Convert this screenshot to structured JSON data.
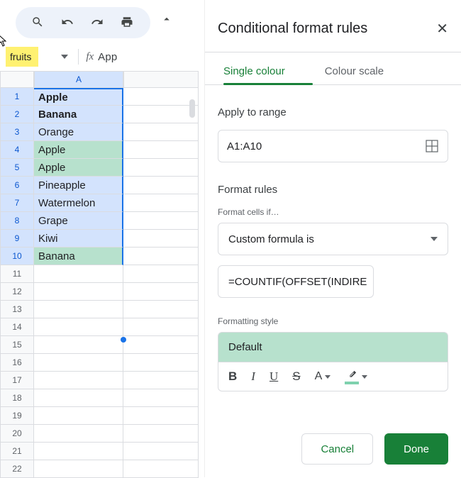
{
  "nameBox": "fruits",
  "formulaBar": "App",
  "columnHeaders": {
    "A": "A"
  },
  "rows": [
    {
      "n": 1,
      "A": "Apple",
      "bold": true,
      "hl": false
    },
    {
      "n": 2,
      "A": "Banana",
      "bold": true,
      "hl": false
    },
    {
      "n": 3,
      "A": "Orange",
      "bold": false,
      "hl": false
    },
    {
      "n": 4,
      "A": "Apple",
      "bold": false,
      "hl": true
    },
    {
      "n": 5,
      "A": "Apple",
      "bold": false,
      "hl": true
    },
    {
      "n": 6,
      "A": "Pineapple",
      "bold": false,
      "hl": false
    },
    {
      "n": 7,
      "A": "Watermelon",
      "bold": false,
      "hl": false
    },
    {
      "n": 8,
      "A": "Grape",
      "bold": false,
      "hl": false
    },
    {
      "n": 9,
      "A": "Kiwi",
      "bold": false,
      "hl": false
    },
    {
      "n": 10,
      "A": "Banana",
      "bold": false,
      "hl": true
    }
  ],
  "emptyRowsFrom": 11,
  "emptyRowsTo": 22,
  "panel": {
    "title": "Conditional format rules",
    "tabs": {
      "single": "Single colour",
      "scale": "Colour scale"
    },
    "applyToRange": {
      "label": "Apply to range",
      "value": "A1:A10"
    },
    "formatRules": {
      "label": "Format rules",
      "conditionLabel": "Format cells if…",
      "conditionValue": "Custom formula is",
      "formula": "=COUNTIF(OFFSET(INDIRE"
    },
    "formattingStyle": {
      "label": "Formatting style",
      "preview": "Default"
    },
    "buttons": {
      "cancel": "Cancel",
      "done": "Done"
    }
  },
  "colors": {
    "highlight": "#b7e1cd",
    "accent": "#188038",
    "selection": "#1a73e8"
  }
}
